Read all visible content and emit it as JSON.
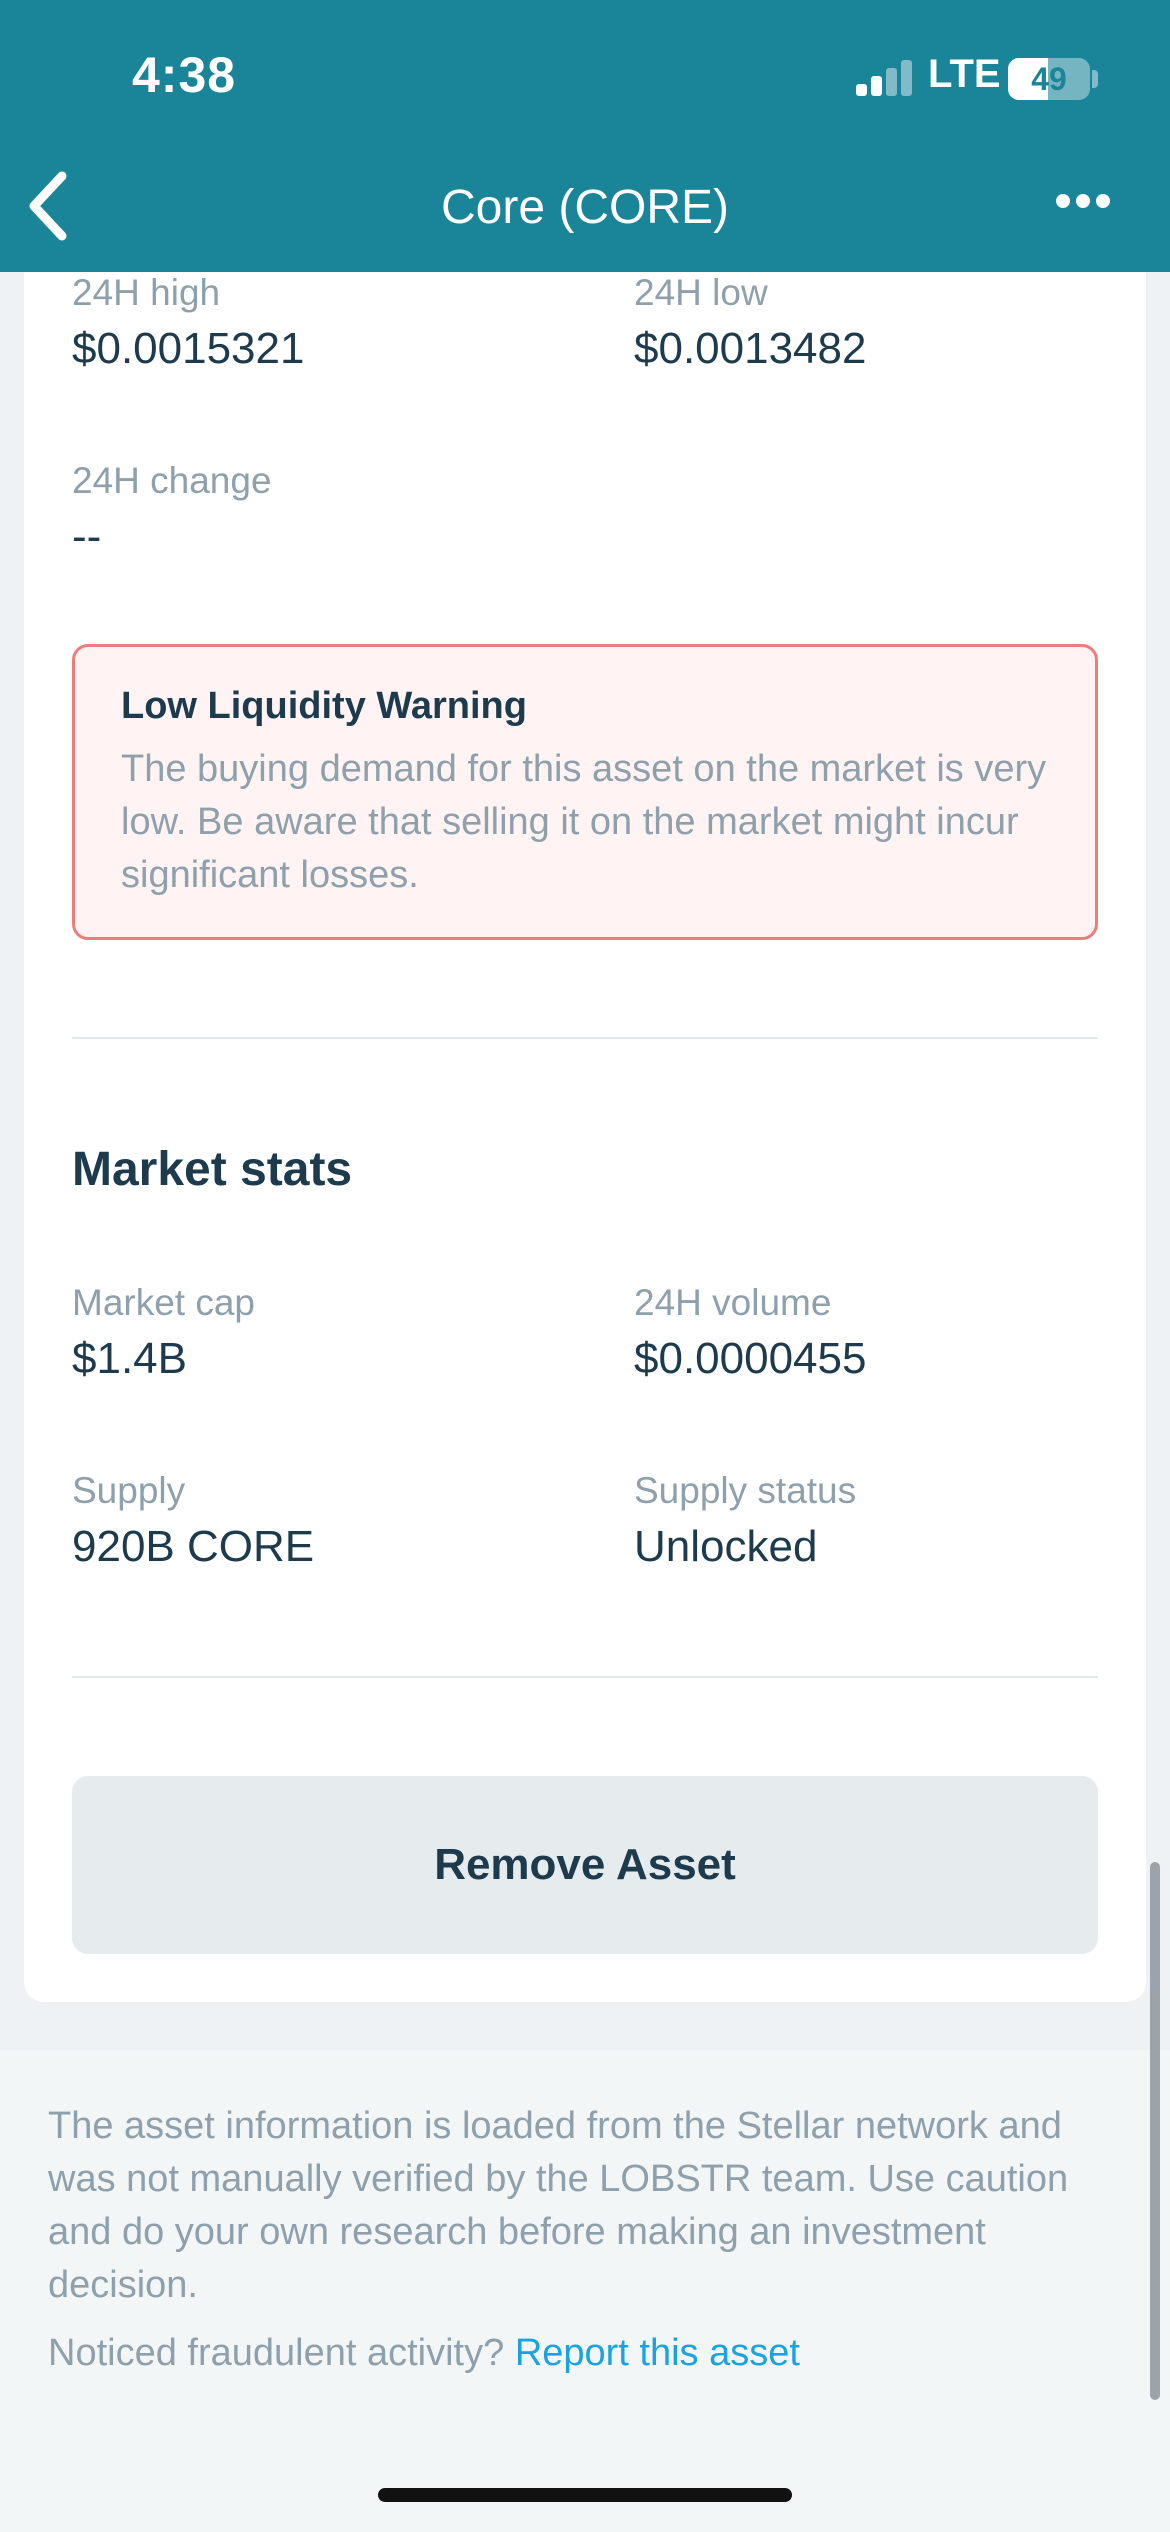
{
  "status_bar": {
    "time": "4:38",
    "network": "LTE",
    "battery_level": 49,
    "battery_text": "49",
    "signal_bars_active": 2,
    "signal_bars_total": 4
  },
  "nav": {
    "back_icon": "chevron-left-icon",
    "title": "Core (CORE)",
    "more_icon": "more-horizontal-icon"
  },
  "price_stats": {
    "high_label": "24H high",
    "high_value": "$0.0015321",
    "low_label": "24H low",
    "low_value": "$0.0013482",
    "change_label": "24H change",
    "change_value": "--"
  },
  "warning": {
    "title": "Low Liquidity Warning",
    "text": "The buying demand for this asset on the market is very low. Be aware that selling it on the market might incur significant losses."
  },
  "market_stats": {
    "title": "Market stats",
    "market_cap_label": "Market cap",
    "market_cap_value": "$1.4B",
    "volume_label": "24H volume",
    "volume_value": "$0.0000455",
    "supply_label": "Supply",
    "supply_value": "920B CORE",
    "supply_status_label": "Supply status",
    "supply_status_value": "Unlocked"
  },
  "actions": {
    "remove_label": "Remove Asset"
  },
  "footer": {
    "disclaimer": "The asset information is loaded from the Stellar network and was not manually verified by the LOBSTR team. Use caution and do your own research before making an investment decision.",
    "report_prefix": "Noticed fraudulent activity? ",
    "report_link": "Report this asset"
  },
  "colors": {
    "header_bg": "#1a8499",
    "primary_text": "#1d3b4d",
    "secondary_text": "#8da0ab",
    "warning_bg": "#fff3f3",
    "warning_border": "#ef7c7c",
    "link": "#1ba3e0",
    "button_bg": "#e6eced"
  }
}
